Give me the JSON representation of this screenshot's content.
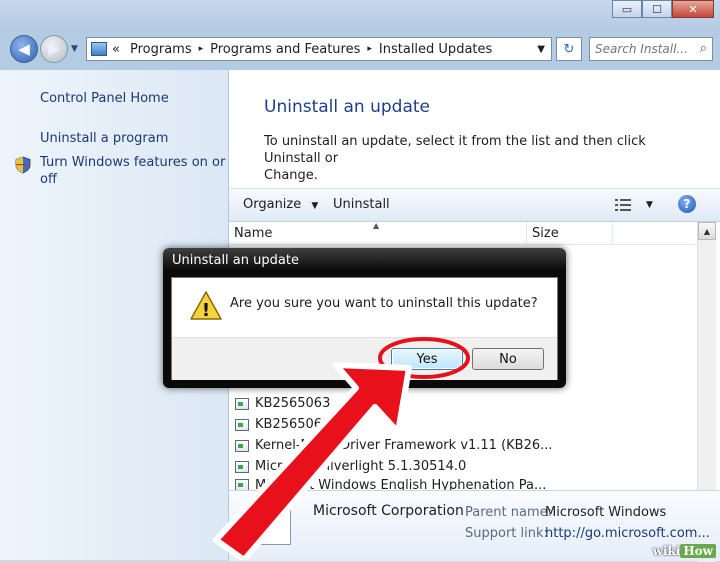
{
  "window": {
    "caption_buttons": {
      "minimize": "▭",
      "maximize": "☐",
      "close": "✕"
    },
    "colors": {
      "accent": "#1e3f8a",
      "link": "#1b3a74",
      "frame": "#b4cbe4"
    }
  },
  "nav": {
    "back_icon": "◀",
    "forward_icon": "▶",
    "history_icon": "▼",
    "address": {
      "overflow": "«",
      "crumbs": [
        "Programs",
        "Programs and Features",
        "Installed Updates"
      ],
      "separator": "▸",
      "dropdown_icon": "▼"
    },
    "refresh_icon": "↻",
    "search": {
      "placeholder": "Search Install...",
      "icon": "⌕"
    }
  },
  "sidebar": {
    "home": "Control Panel Home",
    "uninstall_program": "Uninstall a program",
    "features_line1": "Turn Windows features on or",
    "features_line2": "off"
  },
  "main": {
    "title": "Uninstall an update",
    "description_line1": "To uninstall an update, select it from the list and then click Uninstall or",
    "description_line2": "Change.",
    "toolbar": {
      "organize": "Organize",
      "organize_arrow": "▼",
      "uninstall": "Uninstall",
      "view_arrow": "▼",
      "help": "?"
    },
    "columns": {
      "name": "Name",
      "size": "Size",
      "sort_icon": "▲",
      "scroll_up": "▲"
    },
    "rows": [
      "KB2565063",
      "KB2565063",
      "Kernel-Mode Driver Framework v1.11 (KB26...",
      "Microsoft Silverlight 5.1.30514.0",
      "Microsoft Windows English Hyphenation Pa..."
    ],
    "details": {
      "publisher": "Microsoft Corporation",
      "parent_label": "Parent name:",
      "parent_value": "Microsoft Windows",
      "support_label": "Support link:",
      "support_value": "http://go.microsoft.com..."
    }
  },
  "dialog": {
    "title": "Uninstall an update",
    "message": "Are you sure you want to uninstall this update?",
    "yes": "Yes",
    "no": "No",
    "warning_mark": "!"
  },
  "watermark": {
    "part1": "wiki",
    "part2": "How"
  },
  "annotation": {
    "color": "#e8101a"
  }
}
